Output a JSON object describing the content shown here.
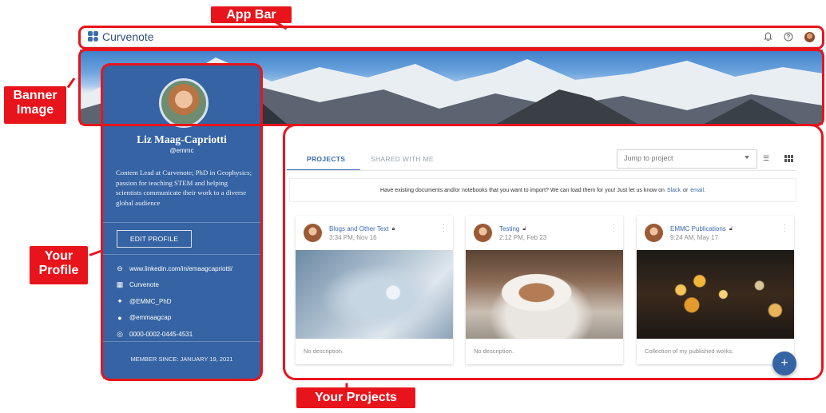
{
  "annotations": {
    "app_bar": "App Bar",
    "banner_line1": "Banner",
    "banner_line2": "Image",
    "profile_line1": "Your",
    "profile_line2": "Profile",
    "projects": "Your Projects"
  },
  "app_bar": {
    "brand": "Curvenote",
    "icons": [
      "bell-icon",
      "help-icon",
      "avatar"
    ]
  },
  "profile": {
    "name": "Liz Maag-Capriotti",
    "handle": "@emmc",
    "bio": "Content Lead at Curvenote; PhD in Geophysics; passion for teaching STEM and helping scientists communicate their work to a diverse global audience",
    "edit_label": "EDIT PROFILE",
    "links": [
      {
        "icon": "link-icon",
        "text": "www.linkedin.com/in/emaagcapriotti/"
      },
      {
        "icon": "organization-icon",
        "text": "Curvenote"
      },
      {
        "icon": "twitter-icon",
        "text": "@EMMC_PhD"
      },
      {
        "icon": "github-icon",
        "text": "@emmaagcap"
      },
      {
        "icon": "orcid-icon",
        "text": "0000-0002-0445-4531"
      }
    ],
    "member_since": "MEMBER SINCE: JANUARY 19, 2021"
  },
  "projects": {
    "tabs": [
      {
        "label": "PROJECTS",
        "active": true
      },
      {
        "label": "SHARED WITH ME",
        "active": false
      }
    ],
    "jump_placeholder": "Jump to project",
    "notice": {
      "text_before": "Have existing documents and/or notebooks that you want to import? We can load them for you! Just let us know on",
      "slack": "Slack",
      "or": "or",
      "email": "email."
    },
    "cards": [
      {
        "title": "Blogs and Other Text",
        "lock": "locked-icon",
        "time": "3:34 PM, Nov 16",
        "description": "No description.",
        "image": "snowflake"
      },
      {
        "title": "Testing",
        "lock": "unlocked-icon",
        "time": "2:12 PM, Feb 23",
        "description": "No description.",
        "image": "coffee"
      },
      {
        "title": "EMMC Publications",
        "lock": "unlocked-icon",
        "time": "9:24 AM, May 17",
        "description": "Collection of my published works.",
        "image": "bokeh"
      }
    ],
    "fab_label": "+"
  },
  "colors": {
    "annotation_red": "#e8141c",
    "profile_blue": "#3563a3",
    "link_blue": "#3a6ab0"
  }
}
